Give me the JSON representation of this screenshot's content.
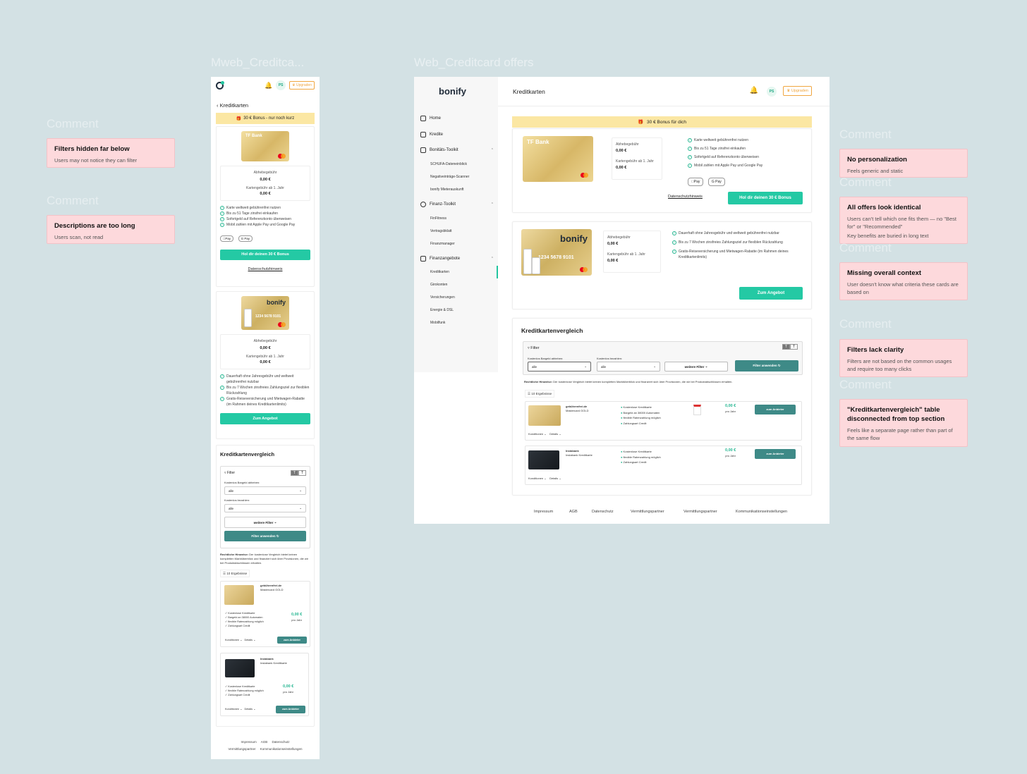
{
  "frames": {
    "mweb": "Mweb_Creditca...",
    "web": "Web_Creditcard offers"
  },
  "comments": [
    {
      "label": "Comment",
      "title": "Filters hidden far below",
      "body": "Users may not notice they can filter"
    },
    {
      "label": "Comment",
      "title": "Descriptions  are too long",
      "body": "Users scan, not read"
    },
    {
      "label": "Comment",
      "title": "No personalization",
      "body": "Feels generic and static"
    },
    {
      "label": "Comment",
      "title": "All offers look identical",
      "body": "Users can't tell which one fits them — no \"Best for\" or \"Recommended\"",
      "body2": "Key benefits are buried in long text"
    },
    {
      "label": "Comment",
      "title": "Missing overall context",
      "body": "User doesn't know what criteria these cards are based on"
    },
    {
      "label": "Comment",
      "title": "Filters lack clarity",
      "body": "Filters are not based on the common usages and require too many clicks"
    },
    {
      "label": "Comment",
      "title": "\"Kreditkartenvergleich\" table disconnected from top section",
      "body": "Feels like a separate page rather than part of the same flow"
    }
  ],
  "common": {
    "avatar": "PS",
    "upgrade": "Upgraden",
    "bonify": "bonify",
    "tfbank": "TF Bank",
    "card_number": "1234 5678 9101",
    "fee_label": "Abhebegebühr",
    "fee_value": "0,00 €",
    "card_fee_label": "Kartengebühr ab 1. Jahr",
    "card_fee_value": "0,00 €",
    "apple_pay": "Pay",
    "google_pay": "G Pay",
    "privacy": "Datenschutzhinweis",
    "offer_btn": "Zum Angebot",
    "section_title": "Kreditkartenvergleich",
    "filter": "Filter",
    "filter_cash": "Kostenlos Bargeld abheben:",
    "filter_pay": "Kostenlos bezahlen:",
    "filter_all": "alle",
    "more_filters": "weitere Filter",
    "apply_filter": "Filter anwenden",
    "legal_bold": "Rechtliche Hinweise:",
    "legal_text": "Der kostenlose Vergleich bietet keinen kompletten Marktüberblick und finanziert sich über Provisionen, die wir bei Produktabschlüssen erhalten.",
    "results": "10 Ergebnisse",
    "conditions": "Konditionen",
    "details": "Details",
    "to_provider": "zum Anbieter",
    "per_year": "pro Jahr"
  },
  "mobile": {
    "back": "Kreditkarten",
    "banner": "30 € Bonus - nur noch kurz",
    "bonus_btn": "Hol dir deinen 30 € Bonus",
    "offer1_features": [
      "Karte weltweit gebührenfrei nutzen",
      "Bis zu 51 Tage zinsfrei einkaufen",
      "Sofortgeld auf Referenzkonto überweisen",
      "Mobil zahlen mit Apple Pay und Google Pay"
    ],
    "offer2_features": [
      "Dauerhaft ohne Jahresgebühr und weltweit gebührenfrei nutzbar",
      "Bis zu 7 Wochen zinsfreies Zahlungsziel zur flexiblen Rückzahlung",
      "Gratis-Reiseversicherung und Mietwagen-Rabatte (im Rahmen deines Kreditkartenlimits)"
    ],
    "rows": [
      {
        "name": "gebührenfrei.de",
        "sub": "Mastercard GOLD",
        "price": "0,00 €",
        "features": [
          "Kostenlose Kreditkarte",
          "Bargeld an 38000 Automaten",
          "flexible Ratenzahlung möglich",
          "Zahlungsart Credit"
        ]
      },
      {
        "name": "Instabank",
        "sub": "Instabank Kreditkarte",
        "price": "0,00 €",
        "features": [
          "Kostenlose Kreditkarte",
          "flexible Ratenzahlung möglich",
          "Zahlungsart Credit"
        ]
      }
    ],
    "footer": [
      "Impressum",
      "AGB",
      "Datenschutz",
      "Vermittlungspartner",
      "Kommunikationseinstellungen"
    ]
  },
  "web": {
    "title": "Kreditkarten",
    "banner": "30 € Bonus für dich",
    "bonus_btn": "Hol dir deinen 30 € Bonus",
    "sidebar": {
      "home": "Home",
      "kredite": "Kredite",
      "bonitaet": "Bonitäts-Toolkit",
      "bonitaet_sub": [
        "SCHUFA-Dateneinblick",
        "Negativeinträge-Scanner",
        "bonify Mieterauskunft"
      ],
      "finanz": "Finanz-Toolkit",
      "finanz_sub": [
        "FinFitness",
        "Vertragsbklatt",
        "Finanzmanager"
      ],
      "angebote": "Finanzangebote",
      "angebote_sub": [
        "Kreditkarten",
        "Girokonten",
        "Versicherungen",
        "Energie & DSL",
        "Mobilfunk"
      ]
    },
    "offer1_features": [
      "Karte weltweit gebührenfrei nutzen",
      "Bis zu 51 Tage zinsfrei einkaufen",
      "Sofortgeld auf Referenzkonto überweisen",
      "Mobil zahlen mit Apple Pay und Google Pay"
    ],
    "offer2_features": [
      "Dauerhaft ohne Jahresgebühr und weltweit gebührenfrei nutzbar",
      "Bis zu 7 Wochen zinsfreies Zahlungsziel zur flexiblen Rückzahlung",
      "Gratis-Reiseversicherung und Mietwagen-Rabatte (im Rahmen deines Kreditkartenlimits)"
    ],
    "rows": [
      {
        "name": "gebührenfrei.de",
        "sub": "Mastercard GOLD",
        "price": "0,00 €",
        "features": [
          "Kostenlose Kreditkarte",
          "Bargeld an 38000 Automaten",
          "flexible Ratenzahlung möglich",
          "Zahlungsart Credit"
        ]
      },
      {
        "name": "Instabank",
        "sub": "Instabank Kreditkarte",
        "price": "0,00 €",
        "features": [
          "Kostenlose Kreditkarte",
          "flexible Ratenzahlung möglich",
          "Zahlungsart Credit"
        ]
      }
    ],
    "footer": [
      "Impressum",
      "AGB",
      "Datenschutz",
      "Vermittlungspartner",
      "Vermittlungspartner",
      "Kommunikationseinstellungen"
    ]
  },
  "colors": {
    "accent": "#24c9a4",
    "teal": "#3e8a87",
    "banner": "#fbe7a3",
    "note": "#fdd9dc",
    "canvas": "#d3e1e4"
  },
  "icons": [
    "gift-icon",
    "bell-icon",
    "check-circle-icon",
    "chevron-down-icon",
    "filter-icon",
    "home-icon",
    "mastercard-logo"
  ]
}
